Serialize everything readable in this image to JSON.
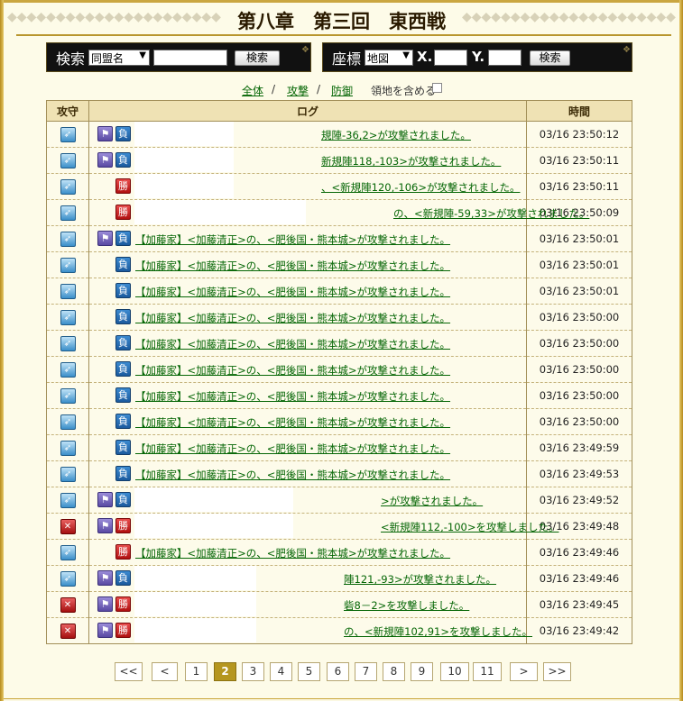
{
  "title": "第八章　第三回　東西戦",
  "search_bar": {
    "label": "検索",
    "select_value": "同盟名",
    "input_value": "",
    "button": "検索"
  },
  "coord_bar": {
    "label": "座標",
    "select_value": "地図",
    "x_label": "X.",
    "y_label": "Y.",
    "x_value": "",
    "y_value": "",
    "button": "検索"
  },
  "filters": {
    "all": "全体",
    "attack": "攻撃",
    "defense": "防御",
    "sep": "/",
    "territory": "領地を含める"
  },
  "table": {
    "headers": [
      "攻守",
      "ログ",
      "時間"
    ],
    "tag_lose": "負",
    "tag_win": "勝",
    "tag_flag": "⚑",
    "rows": [
      {
        "kind": "atk",
        "flag": true,
        "result": "lose",
        "text": "規陣-36,2>が攻撃されました。",
        "time": "03/16 23:50:12"
      },
      {
        "kind": "atk",
        "flag": true,
        "result": "lose",
        "text": "新規陣118,-103>が攻撃されました。",
        "time": "03/16 23:50:11"
      },
      {
        "kind": "atk",
        "flag": false,
        "result": "win",
        "text": "、<新規陣120,-106>が攻撃されました。",
        "time": "03/16 23:50:11"
      },
      {
        "kind": "atk",
        "flag": false,
        "result": "win",
        "text": "の、<新規陣-59,33>が攻撃されました。",
        "time": "03/16 23:50:09"
      },
      {
        "kind": "atk",
        "flag": true,
        "result": "lose",
        "text": "【加藤家】<加藤清正>の、<肥後国・熊本城>が攻撃されました。",
        "time": "03/16 23:50:01"
      },
      {
        "kind": "atk",
        "flag": false,
        "result": "lose",
        "text": "【加藤家】<加藤清正>の、<肥後国・熊本城>が攻撃されました。",
        "time": "03/16 23:50:01"
      },
      {
        "kind": "atk",
        "flag": false,
        "result": "lose",
        "text": "【加藤家】<加藤清正>の、<肥後国・熊本城>が攻撃されました。",
        "time": "03/16 23:50:01"
      },
      {
        "kind": "atk",
        "flag": false,
        "result": "lose",
        "text": "【加藤家】<加藤清正>の、<肥後国・熊本城>が攻撃されました。",
        "time": "03/16 23:50:00"
      },
      {
        "kind": "atk",
        "flag": false,
        "result": "lose",
        "text": "【加藤家】<加藤清正>の、<肥後国・熊本城>が攻撃されました。",
        "time": "03/16 23:50:00"
      },
      {
        "kind": "atk",
        "flag": false,
        "result": "lose",
        "text": "【加藤家】<加藤清正>の、<肥後国・熊本城>が攻撃されました。",
        "time": "03/16 23:50:00"
      },
      {
        "kind": "atk",
        "flag": false,
        "result": "lose",
        "text": "【加藤家】<加藤清正>の、<肥後国・熊本城>が攻撃されました。",
        "time": "03/16 23:50:00"
      },
      {
        "kind": "atk",
        "flag": false,
        "result": "lose",
        "text": "【加藤家】<加藤清正>の、<肥後国・熊本城>が攻撃されました。",
        "time": "03/16 23:50:00"
      },
      {
        "kind": "atk",
        "flag": false,
        "result": "lose",
        "text": "【加藤家】<加藤清正>の、<肥後国・熊本城>が攻撃されました。",
        "time": "03/16 23:49:59"
      },
      {
        "kind": "atk",
        "flag": false,
        "result": "lose",
        "text": "【加藤家】<加藤清正>の、<肥後国・熊本城>が攻撃されました。",
        "time": "03/16 23:49:53"
      },
      {
        "kind": "atk",
        "flag": true,
        "result": "lose",
        "text": ">が攻撃されました。",
        "time": "03/16 23:49:52"
      },
      {
        "kind": "def",
        "flag": true,
        "result": "win",
        "text": "<新規陣112,-100>を攻撃しました。",
        "time": "03/16 23:49:48"
      },
      {
        "kind": "atk",
        "flag": false,
        "result": "win",
        "text": "【加藤家】<加藤清正>の、<肥後国・熊本城>が攻撃されました。",
        "time": "03/16 23:49:46"
      },
      {
        "kind": "atk",
        "flag": true,
        "result": "lose",
        "text": "陣121,-93>が攻撃されました。",
        "time": "03/16 23:49:46"
      },
      {
        "kind": "def",
        "flag": true,
        "result": "win",
        "text": "砦8－2>を攻撃しました。",
        "time": "03/16 23:49:45"
      },
      {
        "kind": "def",
        "flag": true,
        "result": "win",
        "text": "の、<新規陣102,91>を攻撃しました。",
        "time": "03/16 23:49:42"
      }
    ]
  },
  "pager": {
    "first": "<<",
    "prev": "<",
    "next": ">",
    "last": ">>",
    "pages": [
      "1",
      "2",
      "3",
      "4",
      "5",
      "6",
      "7",
      "8",
      "9",
      "10",
      "11"
    ],
    "current": "2"
  }
}
